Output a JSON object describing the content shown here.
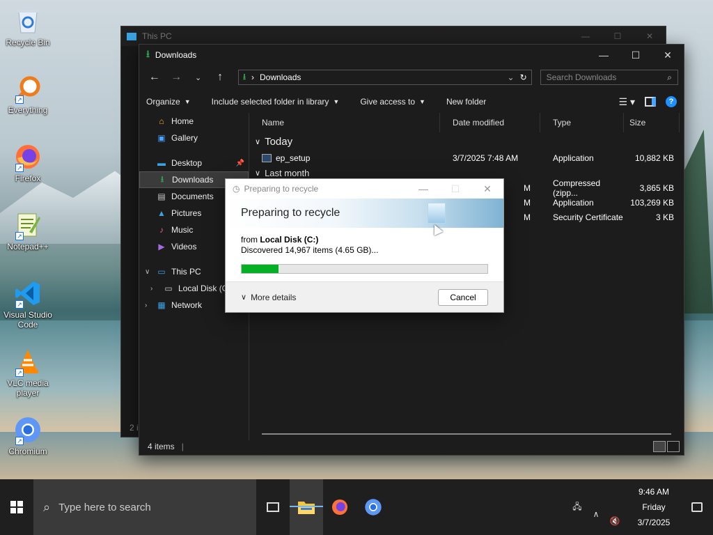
{
  "desktop": {
    "icons": [
      {
        "label": "Recycle Bin",
        "icon": "recycle-bin-icon"
      },
      {
        "label": "Everything",
        "icon": "everything-search-icon"
      },
      {
        "label": "Firefox",
        "icon": "firefox-icon"
      },
      {
        "label": "Notepad++",
        "icon": "notepad-plus-plus-icon"
      },
      {
        "label": "Visual Studio Code",
        "icon": "vscode-icon"
      },
      {
        "label": "VLC media player",
        "icon": "vlc-icon"
      },
      {
        "label": "Chromium",
        "icon": "chromium-icon"
      }
    ]
  },
  "bg_window": {
    "title": "This PC",
    "status": "2 i"
  },
  "explorer": {
    "title": "Downloads",
    "address": {
      "path": "Downloads"
    },
    "search": {
      "placeholder": "Search Downloads"
    },
    "commands": {
      "organize": "Organize",
      "include": "Include selected folder in library",
      "give_access": "Give access to",
      "new_folder": "New folder"
    },
    "nav": {
      "home": "Home",
      "gallery": "Gallery",
      "desktop": "Desktop",
      "downloads": "Downloads",
      "documents": "Documents",
      "pictures": "Pictures",
      "music": "Music",
      "videos": "Videos",
      "this_pc": "This PC",
      "local_disk": "Local Disk (C",
      "network": "Network"
    },
    "columns": {
      "name": "Name",
      "date": "Date modified",
      "type": "Type",
      "size": "Size"
    },
    "groups": {
      "today": "Today",
      "last_month": "Last month"
    },
    "files": [
      {
        "name": "ep_setup",
        "date": "3/7/2025 7:48 AM",
        "type": "Application",
        "size": "10,882 KB"
      },
      {
        "name": "",
        "date": "M",
        "type": "Compressed (zipp...",
        "size": "3,865 KB"
      },
      {
        "name": "",
        "date": "M",
        "type": "Application",
        "size": "103,269 KB"
      },
      {
        "name": "",
        "date": "M",
        "type": "Security Certificate",
        "size": "3 KB"
      }
    ],
    "status": "4 items"
  },
  "dialog": {
    "title": "Preparing to recycle",
    "heading": "Preparing to recycle",
    "from_prefix": "from ",
    "from_source": "Local Disk (C:)",
    "discovered": "Discovered 14,967 items (4.65 GB)...",
    "progress_fraction": 0.15,
    "more_details": "More details",
    "cancel": "Cancel"
  },
  "taskbar": {
    "search_placeholder": "Type here to search",
    "time": "9:46 AM",
    "day": "Friday",
    "date": "3/7/2025"
  },
  "colors": {
    "accent": "#1e90ff",
    "progress": "#06b025",
    "folder_green": "#2ea44f"
  }
}
